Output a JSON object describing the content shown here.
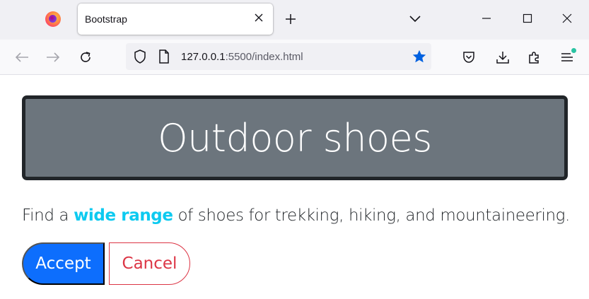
{
  "browser": {
    "tab": {
      "title": "Bootstrap"
    },
    "url": {
      "host": "127.0.0.1",
      "rest": ":5500/index.html"
    },
    "icons": {
      "logo": "firefox-logo-icon",
      "tab_close": "close-icon",
      "new_tab": "plus-icon",
      "list_tabs": "chevron-down-icon",
      "minimize": "minimize-icon",
      "maximize": "maximize-icon",
      "close_window": "close-icon",
      "back": "arrow-left-icon",
      "forward": "arrow-right-icon",
      "reload": "reload-icon",
      "tracking_protection": "shield-icon",
      "page_info": "page-icon",
      "bookmark": "star-icon",
      "pocket": "pocket-icon",
      "downloads": "download-icon",
      "extensions": "puzzle-icon",
      "menu": "hamburger-menu-icon"
    },
    "colors": {
      "bookmark_star": "#0061e0",
      "menu_badge": "#2ac3a2"
    }
  },
  "page": {
    "heading": "Outdoor shoes",
    "lead": {
      "before": "Find a",
      "highlight": "wide range",
      "after": "of shoes for trekking, hiking, and mountaineering."
    },
    "buttons": {
      "accept": "Accept",
      "cancel": "Cancel"
    },
    "colors": {
      "jumbotron_bg": "#6c757d",
      "jumbotron_border": "#212529",
      "highlight": "#0dcaf0",
      "primary": "#0d6efd",
      "danger": "#dc3545"
    }
  }
}
